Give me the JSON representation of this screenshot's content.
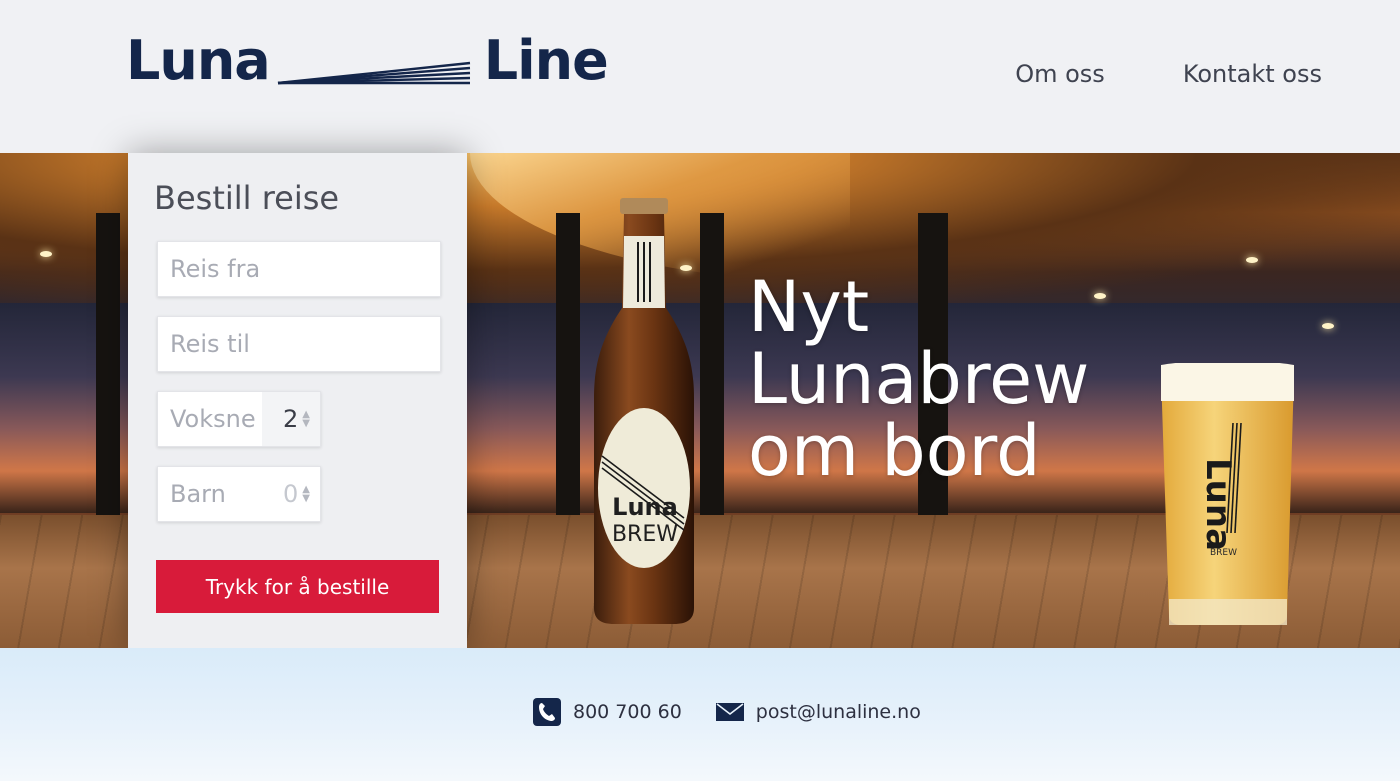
{
  "header": {
    "logo_left": "Luna",
    "logo_right": "Line",
    "nav": [
      {
        "label": "Om oss"
      },
      {
        "label": "Kontakt oss"
      }
    ]
  },
  "booking": {
    "title": "Bestill reise",
    "from_placeholder": "Reis fra",
    "to_placeholder": "Reis til",
    "adults_label": "Voksne",
    "adults_value": "2",
    "children_label": "Barn",
    "children_value": "0",
    "submit_label": "Trykk for å  bestille"
  },
  "hero": {
    "headline_line1": "Nyt",
    "headline_line2": "Lunabrew",
    "headline_line3": "om bord",
    "bottle_label_top": "Luna",
    "bottle_label_bottom": "BREW",
    "glass_label": "Luna",
    "glass_sub": "BREW"
  },
  "footer": {
    "phone": "800 700 60",
    "email": "post@lunaline.no",
    "phone_icon": "phone-icon",
    "email_icon": "envelope-icon"
  },
  "colors": {
    "brand_navy": "#14264a",
    "cta_red": "#d81b3a"
  }
}
